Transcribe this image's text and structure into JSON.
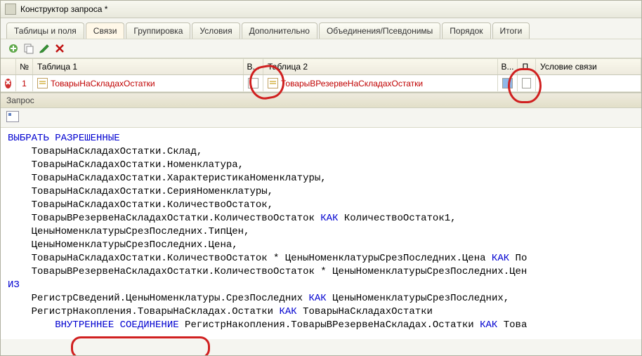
{
  "window": {
    "title": "Конструктор запроса *"
  },
  "tabs": [
    {
      "label": "Таблицы и поля"
    },
    {
      "label": "Связи"
    },
    {
      "label": "Группировка"
    },
    {
      "label": "Условия"
    },
    {
      "label": "Дополнительно"
    },
    {
      "label": "Объединения/Псевдонимы"
    },
    {
      "label": "Порядок"
    },
    {
      "label": "Итоги"
    }
  ],
  "active_tab": 1,
  "grid": {
    "headers": {
      "num": "№",
      "table1": "Таблица 1",
      "all1": "В...",
      "table2": "Таблица 2",
      "all2": "В...",
      "p": "П.",
      "cond": "Условие связи"
    },
    "rows": [
      {
        "num": "1",
        "table1": "ТоварыНаСкладахОстатки",
        "all1": false,
        "table2": "ТоварыВРезервеНаСкладахОстатки",
        "all2": true,
        "p": false,
        "cond": ""
      }
    ]
  },
  "section": {
    "label": "Запрос"
  },
  "code_tokens": [
    {
      "t": "ВЫБРАТЬ РАЗРЕШЕННЫЕ",
      "k": true,
      "nl": true,
      "ind": 0
    },
    {
      "t": "ТоварыНаСкладахОстатки.Склад,",
      "nl": true,
      "ind": 1
    },
    {
      "t": "ТоварыНаСкладахОстатки.Номенклатура,",
      "nl": true,
      "ind": 1
    },
    {
      "t": "ТоварыНаСкладахОстатки.ХарактеристикаНоменклатуры,",
      "nl": true,
      "ind": 1
    },
    {
      "t": "ТоварыНаСкладахОстатки.СерияНоменклатуры,",
      "nl": true,
      "ind": 1
    },
    {
      "t": "ТоварыНаСкладахОстатки.КоличествоОстаток,",
      "nl": true,
      "ind": 1
    },
    {
      "t": "ТоварыВРезервеНаСкладахОстатки.КоличествоОстаток ",
      "ind": 1
    },
    {
      "t": "КАК",
      "k": true
    },
    {
      "t": " КоличествоОстаток1,",
      "nl": true
    },
    {
      "t": "ЦеныНоменклатурыСрезПоследних.ТипЦен,",
      "nl": true,
      "ind": 1
    },
    {
      "t": "ЦеныНоменклатурыСрезПоследних.Цена,",
      "nl": true,
      "ind": 1
    },
    {
      "t": "ТоварыНаСкладахОстатки.КоличествоОстаток * ЦеныНоменклатурыСрезПоследних.Цена ",
      "ind": 1
    },
    {
      "t": "КАК",
      "k": true
    },
    {
      "t": " По",
      "nl": true
    },
    {
      "t": "ТоварыВРезервеНаСкладахОстатки.КоличествоОстаток * ЦеныНоменклатурыСрезПоследних.Цен",
      "nl": true,
      "ind": 1
    },
    {
      "t": "ИЗ",
      "k": true,
      "nl": true,
      "ind": 0
    },
    {
      "t": "РегистрСведений.ЦеныНоменклатуры.СрезПоследних ",
      "ind": 1
    },
    {
      "t": "КАК",
      "k": true
    },
    {
      "t": " ЦеныНоменклатурыСрезПоследних,",
      "nl": true
    },
    {
      "t": "РегистрНакопления.ТоварыНаСкладах.Остатки ",
      "ind": 1
    },
    {
      "t": "КАК",
      "k": true
    },
    {
      "t": " ТоварыНаСкладахОстатки",
      "nl": true
    },
    {
      "t": "ВНУТРЕННЕЕ СОЕДИНЕНИЕ",
      "k": true,
      "ind": 2
    },
    {
      "t": " РегистрНакопления.ТоварыВРезервеНаСкладах.Остатки "
    },
    {
      "t": "КАК",
      "k": true
    },
    {
      "t": " Това",
      "nl": true
    }
  ]
}
